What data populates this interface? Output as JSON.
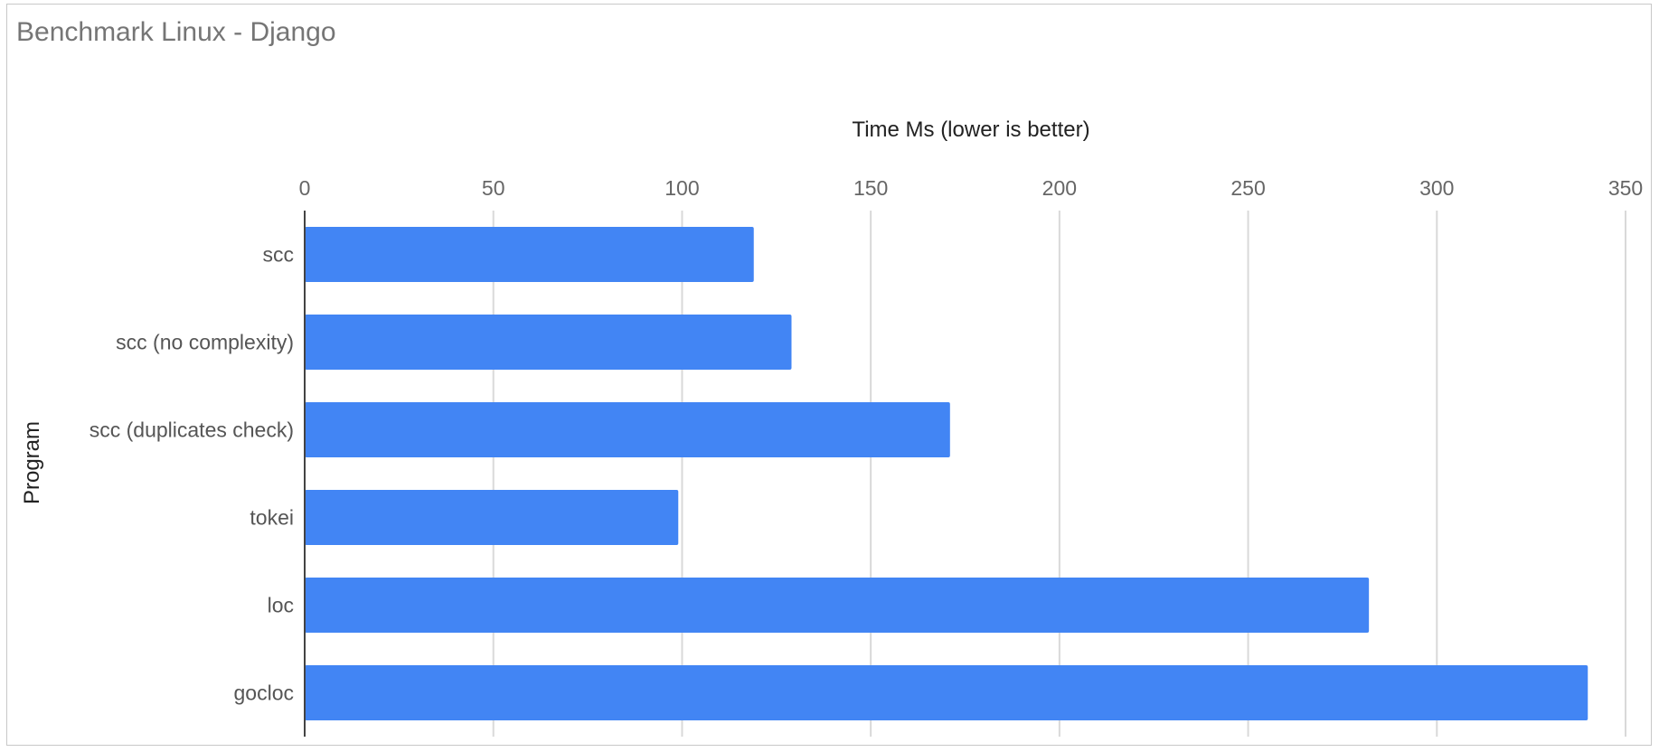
{
  "chart_data": {
    "type": "bar",
    "orientation": "horizontal",
    "title": "Benchmark Linux - Django",
    "xlabel": "Time Ms (lower is better)",
    "ylabel": "Program",
    "categories": [
      "scc",
      "scc (no complexity)",
      "scc (duplicates check)",
      "tokei",
      "loc",
      "gocloc"
    ],
    "values": [
      119,
      129,
      171,
      99,
      282,
      340
    ],
    "xlim": [
      0,
      350
    ],
    "xticks": [
      "0",
      "50",
      "100",
      "150",
      "200",
      "250",
      "300",
      "350"
    ],
    "grid": true,
    "legend": "none",
    "bar_color": "#4285f4",
    "x_axis_position": "top"
  }
}
